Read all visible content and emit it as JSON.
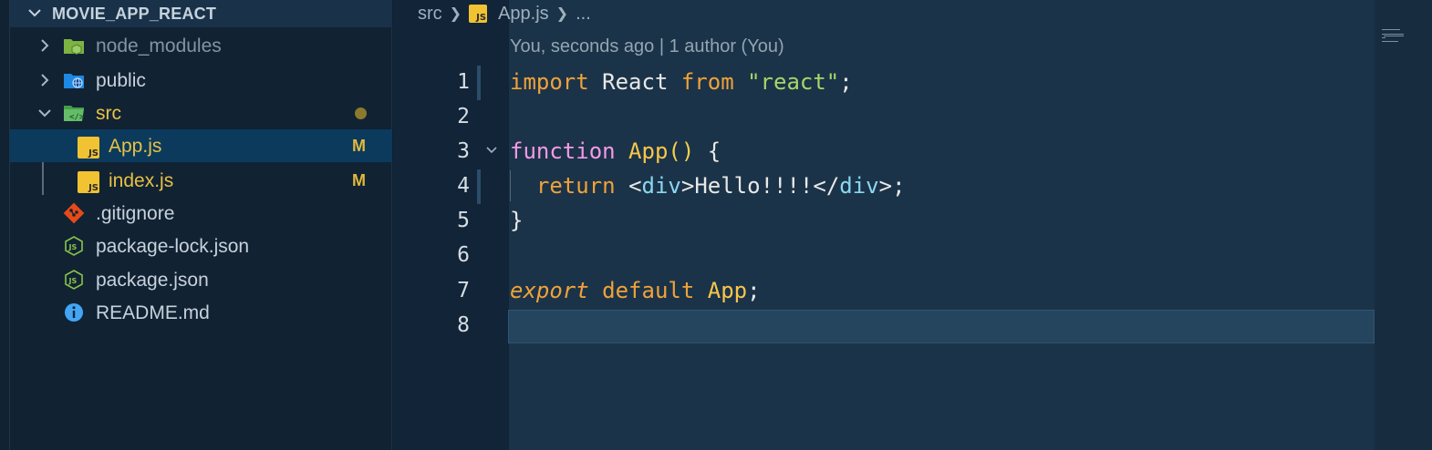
{
  "explorer": {
    "root_folder": "MOVIE_APP_REACT",
    "items": [
      {
        "label": "node_modules",
        "kind": "folder",
        "state": "collapsed",
        "icon": "node-modules-folder-icon"
      },
      {
        "label": "public",
        "kind": "folder",
        "state": "collapsed",
        "icon": "public-folder-icon"
      },
      {
        "label": "src",
        "kind": "folder",
        "state": "expanded",
        "icon": "src-folder-icon",
        "modified_dot": true
      },
      {
        "label": "App.js",
        "kind": "file",
        "icon": "javascript-file-icon",
        "badge": "M",
        "selected": true
      },
      {
        "label": "index.js",
        "kind": "file",
        "icon": "javascript-file-icon",
        "badge": "M"
      },
      {
        "label": ".gitignore",
        "kind": "file",
        "icon": "git-icon"
      },
      {
        "label": "package-lock.json",
        "kind": "file",
        "icon": "nodejs-icon"
      },
      {
        "label": "package.json",
        "kind": "file",
        "icon": "nodejs-icon"
      },
      {
        "label": "README.md",
        "kind": "file",
        "icon": "info-icon"
      }
    ]
  },
  "editor": {
    "breadcrumb": {
      "folder": "src",
      "file": "App.js",
      "more": "..."
    },
    "blame": "You, seconds ago | 1 author (You)",
    "line_numbers": [
      "1",
      "2",
      "3",
      "4",
      "5",
      "6",
      "7",
      "8"
    ],
    "code": {
      "l1": {
        "t1": "import",
        "t2": " React ",
        "t3": "from",
        "t4": " ",
        "t5": "\"react\"",
        "t6": ";"
      },
      "l3": {
        "t1": "function",
        "t2": " ",
        "t3": "App",
        "t4": "()",
        "t5": " {"
      },
      "l4": {
        "t1": "  ",
        "t2": "return",
        "t3": " ",
        "t4": "<",
        "t5": "div",
        "t6": ">Hello!!!!</",
        "t7": "div",
        "t8": ">;"
      },
      "l5": {
        "t1": "}"
      },
      "l7": {
        "t1": "export",
        "t2": " ",
        "t3": "default",
        "t4": " ",
        "t5": "App",
        "t6": ";"
      }
    }
  },
  "colors": {
    "sidebar_bg": "#112233",
    "editor_bg": "#1b3348",
    "modified": "#e2b93b",
    "keyword": "#f0a23a",
    "string": "#a6d76a",
    "function_keyword": "#f49ae8",
    "tag": "#8ad7f2"
  }
}
